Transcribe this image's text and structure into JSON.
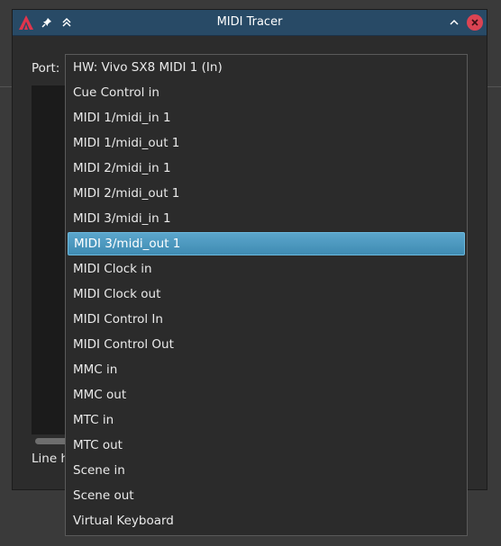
{
  "window": {
    "title": "MIDI Tracer",
    "port_label": "Port:",
    "line_history_label": "Line h"
  },
  "dropdown": {
    "selected_index": 7,
    "options": [
      "HW: Vivo SX8 MIDI 1 (In)",
      "Cue Control in",
      "MIDI 1/midi_in 1",
      "MIDI 1/midi_out 1",
      "MIDI 2/midi_in 1",
      "MIDI 2/midi_out 1",
      "MIDI 3/midi_in 1",
      "MIDI 3/midi_out 1",
      "MIDI Clock in",
      "MIDI Clock out",
      "MIDI Control In",
      "MIDI Control Out",
      "MMC in",
      "MMC out",
      "MTC in",
      "MTC out",
      "Scene in",
      "Scene out",
      "Virtual Keyboard"
    ]
  },
  "colors": {
    "titlebar": "#284a66",
    "selection": "#4a98c0",
    "close": "#da4453",
    "app_icon": "#e0354c"
  },
  "icons": {
    "app": "ardour-logo-icon",
    "pin": "pin-icon",
    "keep_above": "keep-above-icon",
    "minimize": "minimize-icon",
    "close": "close-icon"
  }
}
